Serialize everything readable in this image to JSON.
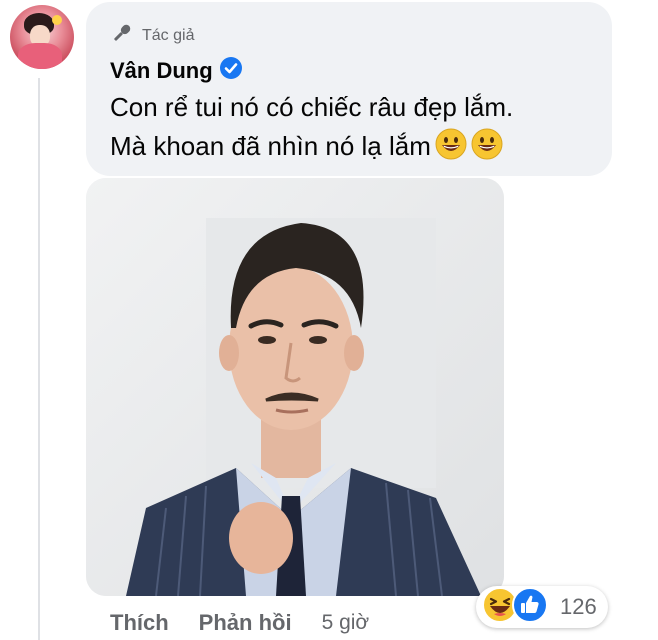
{
  "comment": {
    "badge_label": "Tác giả",
    "author_name": "Vân Dung",
    "lines": [
      "Con rể tui nó có chiếc râu đẹp lắm.",
      "Mà khoan đã nhìn nó lạ lắm"
    ],
    "emoji_icons": [
      "grinning-face-icon",
      "grinning-face-icon"
    ]
  },
  "reactions": {
    "icons": [
      "haha-reaction-icon",
      "like-reaction-icon"
    ],
    "count": "126"
  },
  "actions": {
    "like_label": "Thích",
    "reply_label": "Phản hồi",
    "timestamp": "5 giờ"
  },
  "colors": {
    "bubble_bg": "#f0f2f5",
    "verified_blue": "#1877f2",
    "secondary_text": "#65676b"
  }
}
